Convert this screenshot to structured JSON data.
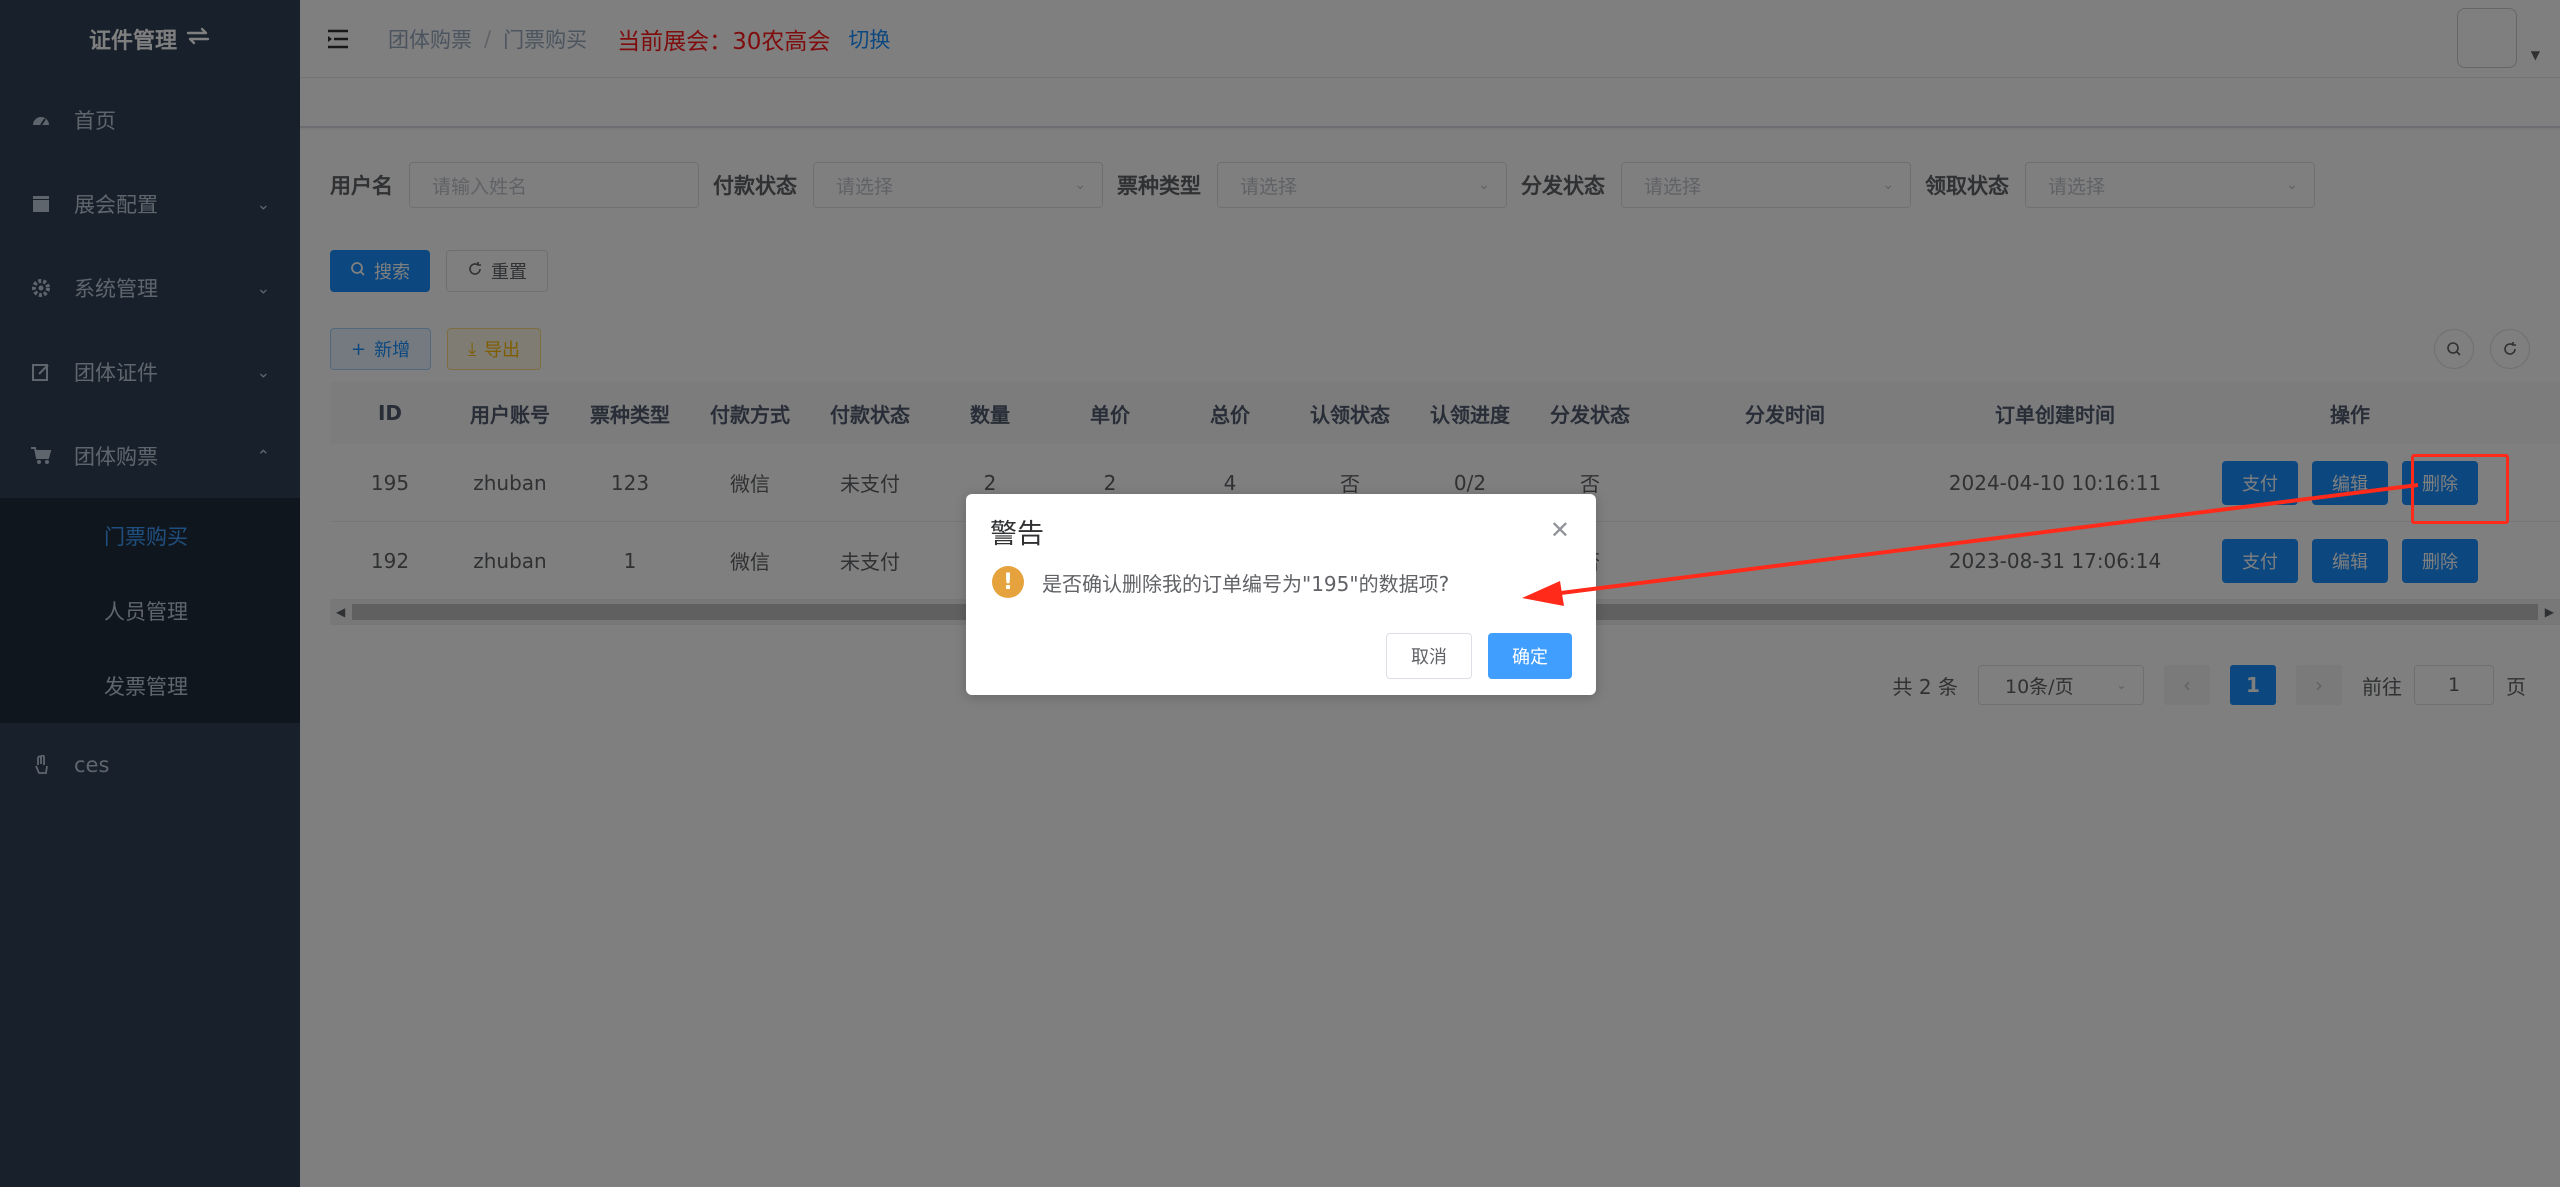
{
  "sidebar": {
    "title": "证件管理",
    "menu": [
      {
        "label": "首页",
        "icon": "dashboard-icon",
        "has_arrow": false
      },
      {
        "label": "展会配置",
        "icon": "clapper-icon",
        "has_arrow": true
      },
      {
        "label": "系统管理",
        "icon": "gear-icon",
        "has_arrow": true
      },
      {
        "label": "团体证件",
        "icon": "edit-icon",
        "has_arrow": true
      },
      {
        "label": "团体购票",
        "icon": "cart-icon",
        "has_arrow": true,
        "expanded": true
      }
    ],
    "submenu": [
      {
        "label": "门票购买",
        "active": true
      },
      {
        "label": "人员管理",
        "active": false
      },
      {
        "label": "发票管理",
        "active": false
      }
    ],
    "extra_item": {
      "label": "ces",
      "icon": "hand-icon"
    }
  },
  "navbar": {
    "breadcrumb": [
      "团体购票",
      "门票购买"
    ],
    "current_expo_label": "当前展会：",
    "current_expo": "30农高会",
    "switch_label": "切换"
  },
  "filters": [
    {
      "label": "用户名",
      "placeholder": "请输入姓名",
      "dropdown": false
    },
    {
      "label": "付款状态",
      "placeholder": "请选择",
      "dropdown": true
    },
    {
      "label": "票种类型",
      "placeholder": "请选择",
      "dropdown": true
    },
    {
      "label": "分发状态",
      "placeholder": "请选择",
      "dropdown": true
    },
    {
      "label": "领取状态",
      "placeholder": "请选择",
      "dropdown": true
    }
  ],
  "buttons": {
    "search": "搜索",
    "reset": "重置",
    "add": "新增",
    "export": "导出"
  },
  "table": {
    "columns": [
      "ID",
      "用户账号",
      "票种类型",
      "付款方式",
      "付款状态",
      "数量",
      "单价",
      "总价",
      "认领状态",
      "认领进度",
      "分发状态",
      "分发时间",
      "订单创建时间",
      "操作"
    ],
    "rows": [
      {
        "id": "195",
        "account": "zhuban",
        "ticket_type": "123",
        "pay_method": "微信",
        "pay_status": "未支付",
        "qty": "2",
        "price": "2",
        "total": "4",
        "claim_status": "否",
        "claim_progress": "0/2",
        "dist_status": "否",
        "dist_time": "",
        "created": "2024-04-10 10:16:11"
      },
      {
        "id": "192",
        "account": "zhuban",
        "ticket_type": "1",
        "pay_method": "微信",
        "pay_status": "未支付",
        "qty": "",
        "price": "",
        "total": "",
        "claim_status": "",
        "claim_progress": "",
        "dist_status": "否",
        "dist_time": "",
        "created": "2023-08-31 17:06:14"
      }
    ],
    "row_actions": [
      "支付",
      "编辑",
      "删除"
    ]
  },
  "pagination": {
    "total_text": "共 2 条",
    "page_size": "10条/页",
    "current_page": "1",
    "goto_label": "前往",
    "goto_value": "1",
    "page_suffix": "页"
  },
  "dialog": {
    "title": "警告",
    "message": "是否确认删除我的订单编号为\"195\"的数据项?",
    "cancel": "取消",
    "confirm": "确定"
  },
  "colors": {
    "sidebar_bg": "#304156",
    "primary": "#1890ff",
    "expo_red": "#ff1a1a",
    "warning": "#e6a23c",
    "annotation_red": "#ff2a1a"
  }
}
